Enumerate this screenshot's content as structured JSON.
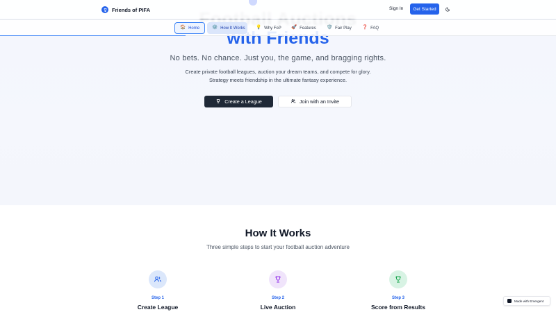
{
  "header": {
    "brand_name": "Friends of PIFA",
    "sign_in_label": "Sign In",
    "get_started_label": "Get Started"
  },
  "hero_ghost": {
    "title": "Football Auctions"
  },
  "section_nav": {
    "items": [
      {
        "icon": "🏠",
        "label": "Home"
      },
      {
        "icon": "⚙️",
        "label": "How It Works"
      },
      {
        "icon": "💡",
        "label": "Why FoP"
      },
      {
        "icon": "🚀",
        "label": "Features"
      },
      {
        "icon": "🛡️",
        "label": "Fair Play"
      },
      {
        "icon": "❓",
        "label": "FAQ"
      }
    ]
  },
  "hero": {
    "title": "with Friends",
    "tagline": "No bets. No chance. Just you, the game, and bragging rights.",
    "description": "Create private football leagues, auction your dream teams, and compete for glory. Strategy meets friendship in the ultimate fantasy experience.",
    "primary_button": "Create a League",
    "secondary_button": "Join with an Invite"
  },
  "how_it_works": {
    "title": "How It Works",
    "subtitle": "Three simple steps to start your football auction adventure",
    "steps": [
      {
        "label": "Step 1",
        "title": "Create League"
      },
      {
        "label": "Step 2",
        "title": "Live Auction"
      },
      {
        "label": "Step 3",
        "title": "Score from Results"
      }
    ]
  },
  "badge": {
    "label": "Made with Emergent"
  },
  "colors": {
    "accent": "#2563eb",
    "dark_button": "#1f2937"
  }
}
